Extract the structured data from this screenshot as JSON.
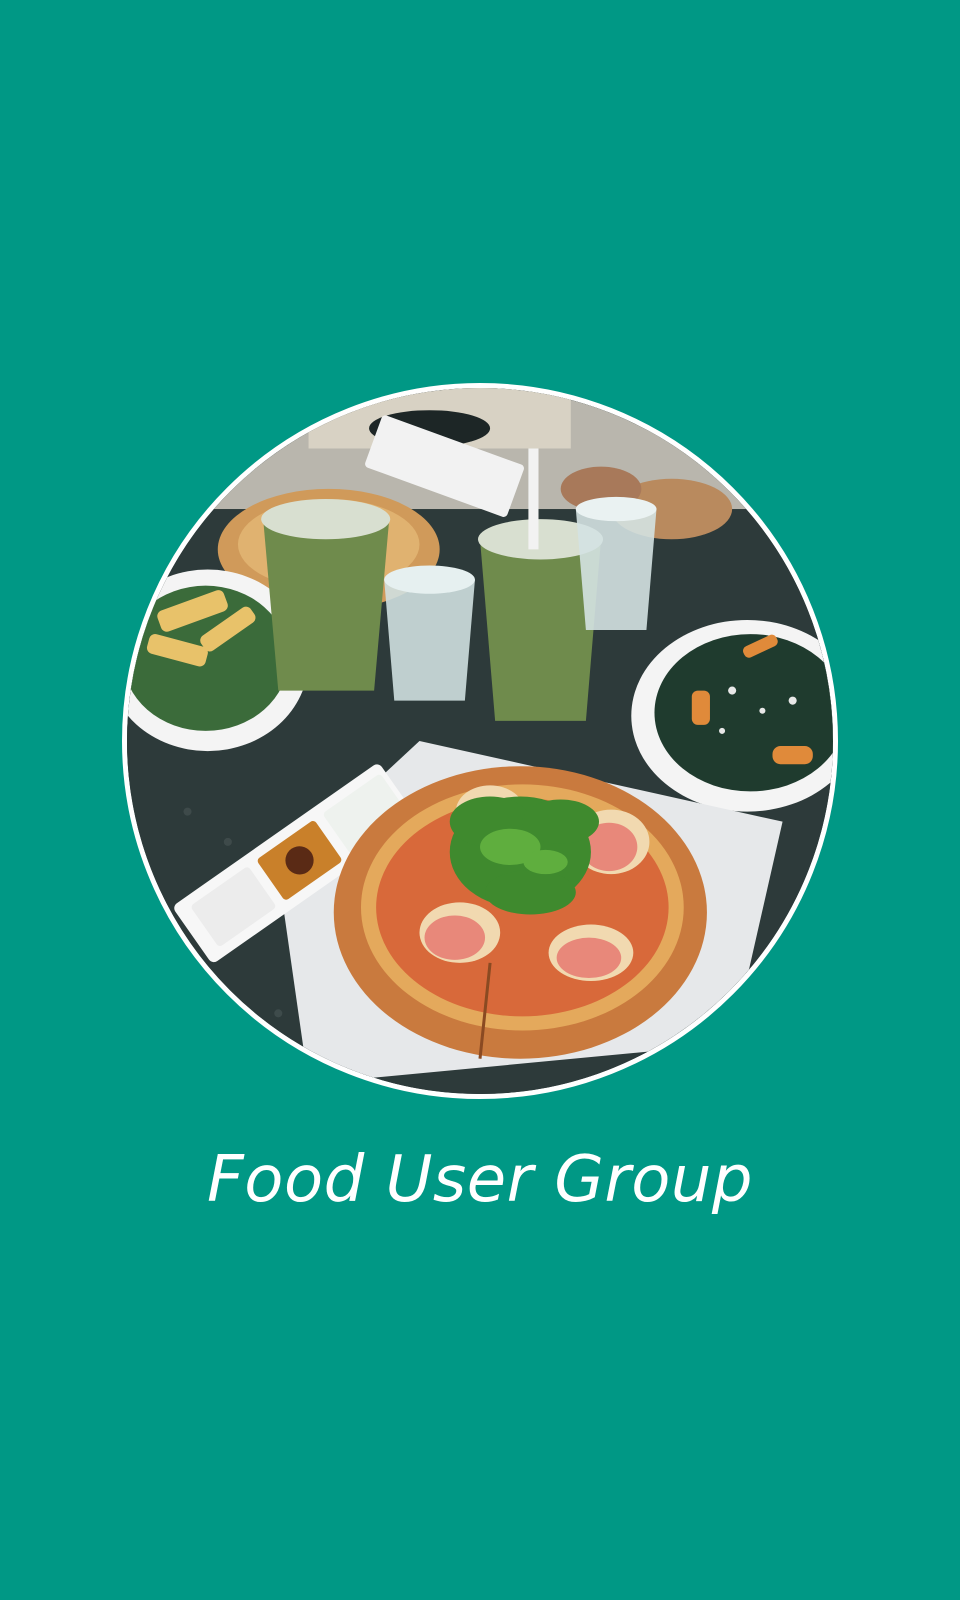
{
  "splash": {
    "title": "Food User Group",
    "image_icon": "food-photo",
    "colors": {
      "background": "#009885",
      "title_text": "#ffffff",
      "photo_border": "#ffffff"
    }
  }
}
